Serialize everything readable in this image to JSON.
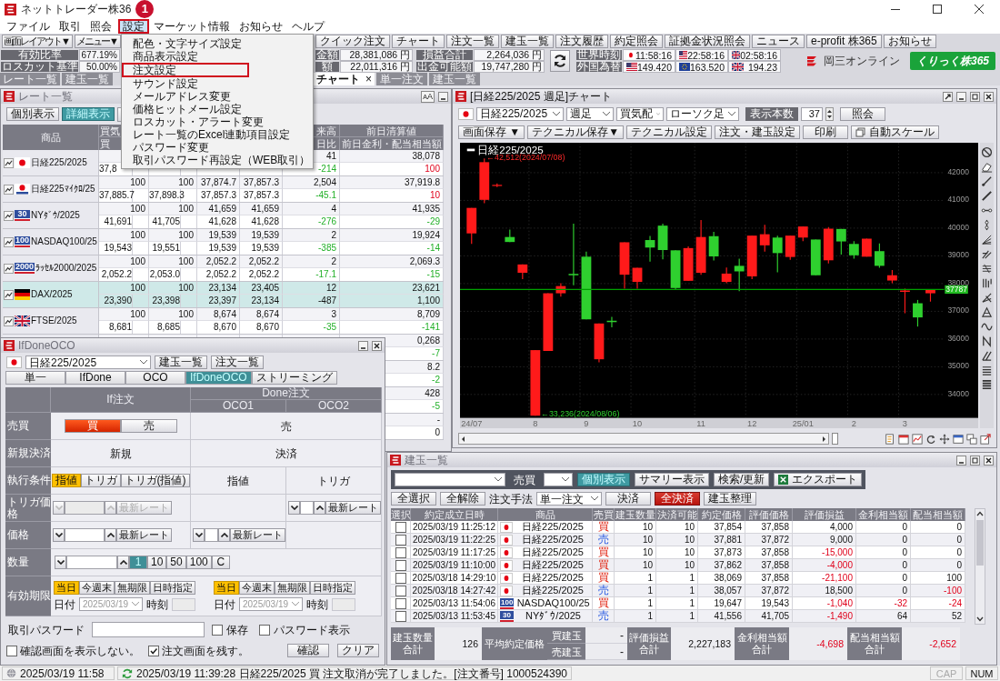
{
  "app": {
    "title": "ネットトレーダー株36",
    "step_badge": "1"
  },
  "menu": [
    {
      "label": "ファイル",
      "selected": false,
      "marked": false
    },
    {
      "label": "取引",
      "selected": false,
      "marked": false
    },
    {
      "label": "照会",
      "selected": false,
      "marked": false
    },
    {
      "label": "設定",
      "selected": true,
      "marked": true
    },
    {
      "label": "マーケット情報",
      "selected": false,
      "marked": false
    },
    {
      "label": "お知らせ",
      "selected": false,
      "marked": false
    },
    {
      "label": "ヘルプ",
      "selected": false,
      "marked": false
    }
  ],
  "settings_menu": [
    {
      "label": "配色・文字サイズ設定",
      "marked": false
    },
    {
      "label": "商品表示設定",
      "marked": false
    },
    {
      "label": "注文設定",
      "marked": true
    },
    {
      "label": "サウンド設定",
      "marked": false
    },
    {
      "label": "メールアドレス変更",
      "marked": false
    },
    {
      "label": "価格ヒットメール設定",
      "marked": false
    },
    {
      "label": "ロスカット・アラート変更",
      "marked": false
    },
    {
      "label": "レート一覧のExcel連動項目設定",
      "marked": false
    },
    {
      "label": "パスワード変更",
      "marked": false
    },
    {
      "label": "取引パスワード再設定（WEB取引）",
      "marked": false
    }
  ],
  "toolbar": {
    "before_menu": [
      "画面レイアウト▼",
      "メニュー▼"
    ],
    "after_menu": [
      "クイック注文",
      "チャート",
      "注文一覧",
      "建玉一覧",
      "注文履歴",
      "約定照会",
      "証拠金状況照会",
      "ニュース",
      "e-profit 株365",
      "お知らせ"
    ]
  },
  "account": {
    "before_menu": [
      {
        "label": "有効比率",
        "value": "677.19%"
      },
      {
        "label": "ロスカット基準",
        "value": "50.00%"
      }
    ],
    "after_menu": [
      [
        {
          "label": "金額",
          "value": "28,381,086 円"
        },
        {
          "label": "額",
          "value": "22,011,316 円"
        }
      ],
      [
        {
          "label": "損益合計",
          "value": "2,264,036 円"
        },
        {
          "label": "出金可能額",
          "value": "19,747,280 円"
        }
      ]
    ]
  },
  "market": {
    "clock_label": "世界時刻",
    "fx_label": "外国為替",
    "clocks": [
      {
        "kind": "japan",
        "value": "11:58:16"
      },
      {
        "kind": "us",
        "value": "22:58:16"
      },
      {
        "kind": "uk",
        "value": "02:58:16"
      }
    ],
    "rates": [
      {
        "kind": "us",
        "value": "149.420"
      },
      {
        "kind": "eu",
        "value": "163.520"
      },
      {
        "kind": "uk",
        "value": "194.23"
      }
    ]
  },
  "brand": {
    "company": "岡三オンライン",
    "service": "くりっく株365"
  },
  "tabs": {
    "before_menu": [
      {
        "label": "レート一覧",
        "selected": false
      },
      {
        "label": "建玉一覧",
        "selected": false
      }
    ],
    "after_menu": [
      {
        "label": "チャート",
        "selected": true,
        "close": "×"
      },
      {
        "label": "単一注文",
        "selected": false
      },
      {
        "label": "建玉一覧",
        "selected": false
      }
    ]
  },
  "rate_list": {
    "title": "レート一覧",
    "font_button": "AA",
    "view_buttons": [
      {
        "label": "個別表示",
        "selected": false
      },
      {
        "label": "詳細表示",
        "selected": true
      }
    ],
    "header": {
      "product": "商品",
      "column_2": [
        "買気",
        "買"
      ],
      "column_6": [
        "来高",
        "日比"
      ],
      "column_7": [
        "前日清算値",
        "前日金利・配当相当額"
      ]
    },
    "rows": [
      {
        "name": "日経225/2025",
        "kind": "japan",
        "selected": false,
        "top": {
          "column_6": "41",
          "column_7": "38,078"
        },
        "bottom": {
          "column_2": {
            "text": "37,8",
            "cut": true
          },
          "column_6": {
            "text": "-214",
            "rising": false
          },
          "column_7": {
            "text": "100",
            "rising": true
          }
        }
      },
      {
        "name": "日経225ﾏｲｸﾛ/25",
        "kind": "japan_micro",
        "selected": false,
        "top": {
          "column_2": "100",
          "column_3": "100",
          "column_4": "37,874.7",
          "column_5": "37,857.3",
          "column_6": "2,504",
          "column_7": "37,919.8"
        },
        "bottom": {
          "column_2": "37,885.7",
          "column_3": "37,898.3",
          "column_4": "37,857.3",
          "column_5": "37,857.3",
          "column_6": {
            "text": "-45.1",
            "rising": false
          },
          "column_7": {
            "text": "10",
            "rising": true
          }
        }
      },
      {
        "name": "NYﾀﾞｳ/2025",
        "kind": "us_index",
        "flag_text": "30",
        "selected": false,
        "top": {
          "column_2": "100",
          "column_3": "100",
          "column_4": "41,659",
          "column_5": "41,659",
          "column_6": "4",
          "column_7": "41,935"
        },
        "bottom": {
          "column_2": "41,691",
          "column_3": "41,705",
          "column_4": "41,628",
          "column_5": "41,628",
          "column_6": {
            "text": "-276",
            "rising": false
          },
          "column_7": {
            "text": "-29",
            "rising": false
          }
        }
      },
      {
        "name": "NASDAQ100/25",
        "kind": "us_index",
        "flag_text": "100",
        "selected": false,
        "top": {
          "column_2": "100",
          "column_3": "100",
          "column_4": "19,539",
          "column_5": "19,539",
          "column_6": "2",
          "column_7": "19,924"
        },
        "bottom": {
          "column_2": "19,543",
          "column_3": "19,551",
          "column_4": "19,539",
          "column_5": "19,539",
          "column_6": {
            "text": "-385",
            "rising": false
          },
          "column_7": {
            "text": "-14",
            "rising": false
          }
        }
      },
      {
        "name": "ﾗｯｾﾙ2000/2025",
        "kind": "us_index",
        "flag_text": "2000",
        "selected": false,
        "top": {
          "column_2": "100",
          "column_3": "100",
          "column_4": "2,052.2",
          "column_5": "2,052.2",
          "column_6": "2",
          "column_7": "2,069.3"
        },
        "bottom": {
          "column_2": "2,052.2",
          "column_3": "2,053.0",
          "column_4": "2,052.2",
          "column_5": "2,052.2",
          "column_6": {
            "text": "-17.1",
            "rising": false
          },
          "column_7": {
            "text": "-15",
            "rising": false
          }
        }
      },
      {
        "name": "DAX/2025",
        "kind": "germany",
        "selected": true,
        "top": {
          "column_2": "100",
          "column_3": "100",
          "column_4": "23,134",
          "column_5": "23,405",
          "column_6": "12",
          "column_7": "23,621"
        },
        "bottom": {
          "column_2": "23,390",
          "column_3": "23,398",
          "column_4": "23,397",
          "column_5": "23,134",
          "column_6": "-487",
          "column_7": "1,100"
        }
      },
      {
        "name": "FTSE/2025",
        "kind": "uk",
        "selected": false,
        "top": {
          "column_2": "100",
          "column_3": "100",
          "column_4": "8,674",
          "column_5": "8,674",
          "column_6": "3",
          "column_7": "8,709"
        },
        "bottom": {
          "column_2": "8,681",
          "column_3": "8,685",
          "column_4": "8,670",
          "column_5": "8,670",
          "column_6": {
            "text": "-35",
            "rising": false
          },
          "column_7": {
            "text": "-141",
            "rising": false
          }
        }
      },
      {
        "top": {
          "column_7": "0,268"
        },
        "bottom": {
          "column_7": {
            "text": "-7",
            "rising": false
          }
        }
      },
      {
        "top": {
          "column_7": "8.2"
        },
        "bottom": {
          "column_7": {
            "text": "-2",
            "rising": false
          }
        }
      },
      {
        "top": {
          "column_7": "428"
        },
        "bottom": {
          "column_7": {
            "text": "-5",
            "rising": false
          }
        }
      },
      {
        "top": {
          "column_7": "-"
        },
        "bottom": {
          "column_7": "0"
        }
      }
    ]
  },
  "order_window": {
    "title": "IfDoneOCO",
    "product": "日経225/2025",
    "buttons": [
      "建玉一覧",
      "注文一覧"
    ],
    "tabs": [
      {
        "label": "単一",
        "selected": false
      },
      {
        "label": "IfDone",
        "selected": false
      },
      {
        "label": "OCO",
        "selected": false
      },
      {
        "label": "IfDoneOCO",
        "selected": true
      },
      {
        "label": "ストリーミング",
        "selected": false
      }
    ],
    "head": {
      "if": "If注文",
      "done": "Done注文",
      "oco1": "OCO1",
      "oco2": "OCO2"
    },
    "rows": [
      {
        "label": "売買",
        "if": {
          "kind": "side",
          "options": [
            {
              "label": "買",
              "selected": true
            },
            {
              "label": "売",
              "selected": false
            }
          ]
        },
        "done": {
          "kind": "text",
          "text": "売"
        }
      },
      {
        "label": "新規決済",
        "if": {
          "kind": "text",
          "text": "新規"
        },
        "done": {
          "kind": "text",
          "text": "決済"
        }
      },
      {
        "label": "執行条件",
        "if": {
          "kind": "choice",
          "options": [
            {
              "label": "指値",
              "selected": true
            },
            {
              "label": "トリガ",
              "selected": false
            },
            {
              "label": "トリガ(指値)",
              "selected": false
            }
          ]
        },
        "oco1": {
          "kind": "text",
          "text": "指値"
        },
        "oco2": {
          "kind": "text",
          "text": "トリガ"
        }
      },
      {
        "label": "トリガ価格",
        "if": {
          "kind": "price",
          "disabled": true,
          "button": "最新レート"
        },
        "oco1": {
          "kind": "blank"
        },
        "oco2": {
          "kind": "price",
          "disabled": false,
          "button": "最新レート"
        }
      },
      {
        "label": "価格",
        "if": {
          "kind": "price",
          "disabled": false,
          "button": "最新レート"
        },
        "oco1": {
          "kind": "price",
          "disabled": false,
          "button": "最新レート"
        },
        "oco2": {
          "kind": "blank"
        }
      },
      {
        "label": "数量",
        "if": {
          "kind": "quantity",
          "presets": [
            {
              "label": "1",
              "selected": true
            },
            {
              "label": "10",
              "selected": false
            },
            {
              "label": "50",
              "selected": false
            },
            {
              "label": "100",
              "selected": false
            },
            {
              "label": "C",
              "selected": false
            }
          ]
        }
      },
      {
        "label": "有効期限",
        "if": {
          "kind": "expiry",
          "options": [
            {
              "label": "当日",
              "selected": true
            },
            {
              "label": "今週末",
              "selected": false
            },
            {
              "label": "無期限",
              "selected": false
            },
            {
              "label": "日時指定",
              "selected": false
            }
          ],
          "date_label": "日付",
          "date": "2025/03/19",
          "time_label": "時刻"
        },
        "done": {
          "kind": "expiry",
          "options": [
            {
              "label": "当日",
              "selected": true
            },
            {
              "label": "今週末",
              "selected": false
            },
            {
              "label": "無期限",
              "selected": false
            },
            {
              "label": "日時指定",
              "selected": false
            }
          ],
          "date_label": "日付",
          "date": "2025/03/19",
          "time_label": "時刻"
        }
      }
    ],
    "password_label": "取引パスワード",
    "save": {
      "label": "保存",
      "checked": false
    },
    "show_password": {
      "label": "パスワード表示",
      "checked": false
    },
    "options": [
      {
        "label": "確認画面を表示しない。",
        "checked": false
      },
      {
        "label": "注文画面を残す。",
        "checked": true
      }
    ],
    "actions": [
      "確認",
      "クリア"
    ]
  },
  "chart_window": {
    "title": "[日経225/2025 週足]チャート",
    "product": "日経225/2025",
    "selects": [
      "週足",
      "買気配",
      "ローソク足"
    ],
    "count_label": "表示本数",
    "count": "37",
    "query_button": "照会",
    "buttons": [
      "画面保存 ▼",
      "テクニカル保存▼",
      "テクニカル設定",
      "注文・建玉設定",
      "印刷"
    ],
    "auto_scale_button": "自動スケール",
    "legend": "日経225/2025",
    "chart_data": {
      "type": "candlestick",
      "categories": [
        "24/07",
        null,
        null,
        null,
        null,
        "8",
        null,
        null,
        null,
        "9",
        null,
        null,
        null,
        "10",
        null,
        null,
        null,
        null,
        "11",
        null,
        null,
        null,
        "12",
        null,
        null,
        null,
        "25/01",
        null,
        null,
        null,
        "2",
        null,
        null,
        null,
        "3",
        null,
        null
      ],
      "ohlc": [
        [
          39810,
          40730,
          39430,
          40730
        ],
        [
          41020,
          42512,
          40900,
          42380
        ],
        [
          41520,
          41610,
          41480,
          41560
        ],
        [
          39680,
          39950,
          39500,
          39500
        ],
        [
          38390,
          38690,
          38160,
          38690
        ],
        [
          33236,
          35600,
          33236,
          35600
        ],
        [
          35570,
          37650,
          35570,
          37650
        ],
        [
          37650,
          38010,
          37530,
          37910
        ],
        [
          38350,
          40160,
          37940,
          38300
        ],
        [
          38970,
          39150,
          36710,
          36710
        ],
        [
          35270,
          36560,
          35160,
          36560
        ],
        [
          36660,
          36800,
          36420,
          36610
        ],
        [
          38320,
          39490,
          37820,
          39490
        ],
        [
          38060,
          38570,
          37820,
          38570
        ],
        [
          39570,
          39720,
          38790,
          39300
        ],
        [
          40090,
          40160,
          38870,
          39210
        ],
        [
          39200,
          39200,
          37780,
          37840
        ],
        [
          38100,
          39340,
          38100,
          39280
        ],
        [
          38390,
          40290,
          38320,
          39680
        ],
        [
          39710,
          39870,
          38830,
          38980
        ],
        [
          38060,
          38580,
          38010,
          38360
        ],
        [
          38640,
          38900,
          37730,
          38440
        ],
        [
          38260,
          39730,
          38160,
          39730
        ],
        [
          39380,
          40120,
          39150,
          39780
        ],
        [
          39660,
          39730,
          38410,
          39100
        ],
        [
          38960,
          39730,
          38860,
          39730
        ],
        [
          39660,
          40060,
          39530,
          40060
        ],
        [
          39590,
          39590,
          38300,
          38300
        ],
        [
          38840,
          40040,
          38730,
          39980
        ],
        [
          39970,
          39970,
          39050,
          39520
        ],
        [
          39430,
          39530,
          38900,
          39020
        ],
        [
          38970,
          39620,
          38970,
          39620
        ],
        [
          39170,
          39450,
          38570,
          38640
        ],
        [
          38110,
          38490,
          38010,
          38300
        ],
        [
          37700,
          37820,
          36930,
          37750
        ],
        [
          37290,
          37410,
          36450,
          36780
        ],
        [
          37650,
          37800,
          37350,
          37787
        ]
      ],
      "ylim": [
        33150,
        43080
      ],
      "yticks": [
        42000,
        41000,
        40000,
        39000,
        38000,
        37000,
        36000,
        35000,
        34000
      ],
      "grid": true,
      "ref_lines": [
        {
          "axis": "y",
          "value": 37787,
          "label": "37787"
        }
      ],
      "annotations": [
        "←42,512(2024/07/08)",
        "←33,236(2024/08/06)"
      ]
    }
  },
  "positions": {
    "title": "建玉一覧",
    "side_label": "売買",
    "view_buttons": [
      {
        "label": "個別表示",
        "selected": true
      },
      {
        "label": "サマリー表示",
        "selected": false
      }
    ],
    "search_button": "検索/更新",
    "export_button": "エクスポート",
    "select_all": "全選択",
    "clear_all": "全解除",
    "method_label": "注文手法",
    "method": "単一注文",
    "settle_button": "決済",
    "settle_all_button": "全決済",
    "tidy_button": "建玉整理",
    "columns": [
      "選択",
      "約定成立日時",
      "商品",
      "売買",
      "建玉数量",
      "決済可能",
      "約定価格",
      "評価価格",
      "評価損益",
      "金利相当額",
      "配当相当額"
    ],
    "rows": [
      {
        "checked": false,
        "time": "2025/03/19 11:25:12",
        "kind": "japan",
        "product": "日経225/2025",
        "side": {
          "text": "買",
          "kind": "buy"
        },
        "qty": "10",
        "settleable": "10",
        "price": "37,854",
        "valuation": "37,858",
        "pnl": {
          "text": "4,000",
          "negative": false
        },
        "interest": {
          "text": "0",
          "negative": false
        },
        "dividend": {
          "text": "0",
          "negative": false
        }
      },
      {
        "checked": false,
        "time": "2025/03/19 11:22:25",
        "kind": "japan",
        "product": "日経225/2025",
        "side": {
          "text": "売",
          "kind": "sell"
        },
        "qty": "10",
        "settleable": "10",
        "price": "37,881",
        "valuation": "37,872",
        "pnl": {
          "text": "9,000",
          "negative": false
        },
        "interest": {
          "text": "0",
          "negative": false
        },
        "dividend": {
          "text": "0",
          "negative": false
        }
      },
      {
        "checked": false,
        "time": "2025/03/19 11:17:25",
        "kind": "japan",
        "product": "日経225/2025",
        "side": {
          "text": "買",
          "kind": "buy"
        },
        "qty": "10",
        "settleable": "10",
        "price": "37,873",
        "valuation": "37,858",
        "pnl": {
          "text": "-15,000",
          "negative": true
        },
        "interest": {
          "text": "0",
          "negative": false
        },
        "dividend": {
          "text": "0",
          "negative": false
        }
      },
      {
        "checked": false,
        "time": "2025/03/19 11:10:00",
        "kind": "japan",
        "product": "日経225/2025",
        "side": {
          "text": "買",
          "kind": "buy"
        },
        "qty": "10",
        "settleable": "10",
        "price": "37,862",
        "valuation": "37,858",
        "pnl": {
          "text": "-4,000",
          "negative": true
        },
        "interest": {
          "text": "0",
          "negative": false
        },
        "dividend": {
          "text": "0",
          "negative": false
        }
      },
      {
        "checked": false,
        "time": "2025/03/18 14:29:10",
        "kind": "japan",
        "product": "日経225/2025",
        "side": {
          "text": "買",
          "kind": "buy"
        },
        "qty": "1",
        "settleable": "1",
        "price": "38,069",
        "valuation": "37,858",
        "pnl": {
          "text": "-21,100",
          "negative": true
        },
        "interest": {
          "text": "0",
          "negative": false
        },
        "dividend": {
          "text": "100",
          "negative": false
        }
      },
      {
        "checked": false,
        "time": "2025/03/18 14:27:42",
        "kind": "japan",
        "product": "日経225/2025",
        "side": {
          "text": "売",
          "kind": "sell"
        },
        "qty": "1",
        "settleable": "1",
        "price": "38,057",
        "valuation": "37,872",
        "pnl": {
          "text": "18,500",
          "negative": false
        },
        "interest": {
          "text": "0",
          "negative": false
        },
        "dividend": {
          "text": "-100",
          "negative": true
        }
      },
      {
        "checked": false,
        "time": "2025/03/13 11:54:06",
        "kind": "us_index",
        "flag_text": "100",
        "product": "NASDAQ100/25",
        "side": {
          "text": "買",
          "kind": "buy"
        },
        "qty": "1",
        "settleable": "1",
        "price": "19,647",
        "valuation": "19,543",
        "pnl": {
          "text": "-1,040",
          "negative": true
        },
        "interest": {
          "text": "-32",
          "negative": true
        },
        "dividend": {
          "text": "-24",
          "negative": true
        }
      },
      {
        "checked": false,
        "time": "2025/03/13 11:53:45",
        "kind": "us_index",
        "flag_text": "30",
        "product": "NYﾀﾞｳ/2025",
        "side": {
          "text": "売",
          "kind": "sell"
        },
        "qty": "1",
        "settleable": "1",
        "price": "41,556",
        "valuation": "41,705",
        "pnl": {
          "text": "-1,490",
          "negative": true
        },
        "interest": {
          "text": "64",
          "negative": false
        },
        "dividend": {
          "text": "52",
          "negative": false
        }
      }
    ],
    "summary": {
      "qty_label": "建玉数量合計",
      "qty": "126",
      "avg_label": "平均約定価格",
      "buy_label": "買建玉",
      "buy": "-",
      "sell_label": "売建玉",
      "sell": "-",
      "pnl_label": "評価損益合計",
      "pnl": {
        "text": "2,227,183",
        "negative": false
      },
      "interest_label": "金利相当額合計",
      "interest": {
        "text": "-4,698",
        "negative": true
      },
      "dividend_label": "配当相当額合計",
      "dividend": {
        "text": "-2,652",
        "negative": true
      }
    }
  },
  "status": {
    "time": "2025/03/19 11:58",
    "message": "2025/03/19 11:39:28 日経225/2025 買 注文取消が完了しました。[注文番号] 1000524390",
    "keys": [
      {
        "label": "CAP",
        "on": false
      },
      {
        "label": "NUM",
        "on": true
      }
    ]
  }
}
